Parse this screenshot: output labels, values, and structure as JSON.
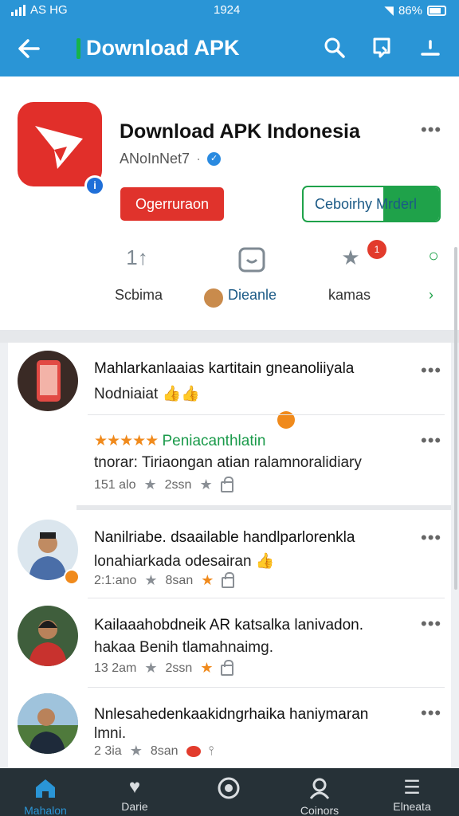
{
  "status_bar": {
    "carrier": "AS HG",
    "time": "1924",
    "battery": "86%"
  },
  "app_bar": {
    "title": "Download APK"
  },
  "app": {
    "name": "Download APK Indonesia",
    "developer": "ANoInNet7",
    "primary_button": "Ogerruraon",
    "secondary_button": "Ceboirhy Mrderl",
    "badge_count": "1",
    "stats": [
      {
        "icon": "sort-icon",
        "glyph": "1↑",
        "label": "Scbima"
      },
      {
        "icon": "smile-icon",
        "glyph": "◡",
        "label": "Dieanle"
      },
      {
        "icon": "star-icon",
        "glyph": "★",
        "label": "kamas"
      },
      {
        "icon": "circle-icon",
        "glyph": "○",
        "label": ""
      }
    ]
  },
  "reviews": [
    {
      "title": "Mahlarkanlaaias kartitain gneanoliiyala",
      "subtitle": "Nodniaiat",
      "emoji": "👍👍"
    },
    {
      "stars": "★★★★★",
      "title": "Peniacanthlatin",
      "subtitle": "tnorar: Tiriaongan atian ralamnoralidiary",
      "age": "151 alo",
      "time": "2ssn"
    },
    {
      "title": "Nanilriabe. dsaailable handlparlorenkla",
      "subtitle": "lonahiarkada odesairan",
      "emoji": "👍",
      "age": "2:1:ano",
      "time": "8san"
    },
    {
      "title": "Kailaaahobdneik AR katsalka lanivadon.",
      "subtitle": "hakaa Benih tlamahnaimg.",
      "age": "13 2am",
      "time": "2ssn"
    },
    {
      "title": "Nnlesahedenkaakidngrhaika haniymaran",
      "subtitle": "lmni.",
      "age": "2 3ia",
      "time": "8san"
    }
  ],
  "bottom_nav": [
    {
      "label": "Mahalon",
      "icon": "home-icon"
    },
    {
      "label": "Darie",
      "icon": "heart-icon"
    },
    {
      "label": "",
      "icon": "record-icon"
    },
    {
      "label": "Coinors",
      "icon": "profile-icon"
    },
    {
      "label": "Elneata",
      "icon": "menu-icon"
    }
  ],
  "colors": {
    "primary": "#2a95d6",
    "accent": "#1fa24a",
    "danger": "#e0332c",
    "star": "#f08a1c",
    "nav_bg": "#263137"
  }
}
